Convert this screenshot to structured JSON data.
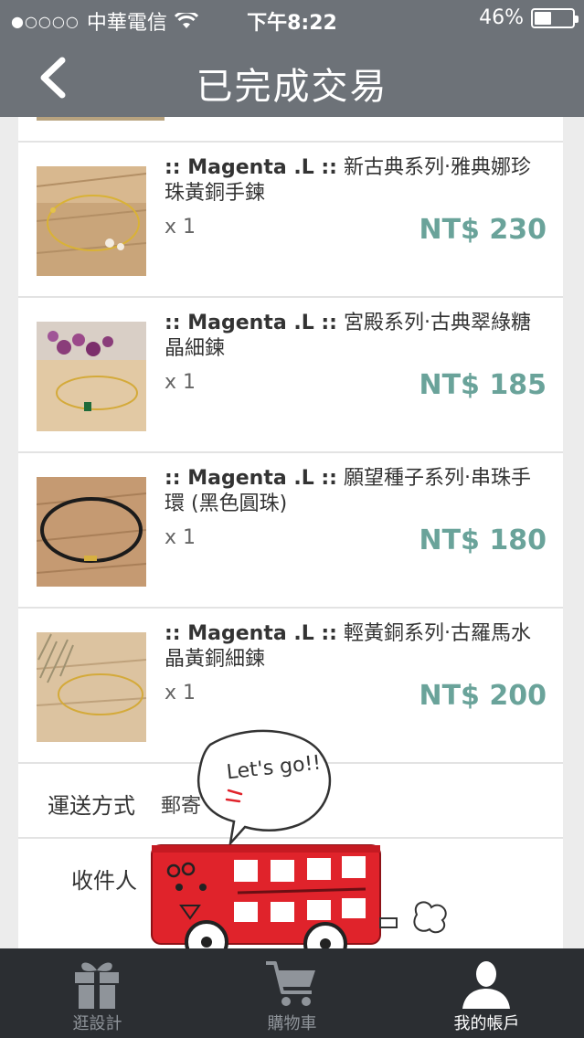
{
  "status_bar": {
    "carrier": "中華電信",
    "time": "下午8:22",
    "battery_pct": "46%",
    "battery_level": 0.46,
    "signal_dots": "●○○○○"
  },
  "nav": {
    "title": "已完成交易",
    "back_icon": "chevron-left-icon"
  },
  "items": [
    {
      "brand": ":: Magenta .L ::",
      "name": " 新古典系列‧雅典娜珍珠黃銅手鍊",
      "qty": "x 1",
      "price": "NT$ 230"
    },
    {
      "brand": ":: Magenta .L ::",
      "name": " 宮殿系列‧古典翠綠糖晶細鍊",
      "qty": "x 1",
      "price": "NT$ 185"
    },
    {
      "brand": ":: Magenta .L ::",
      "name": " 願望種子系列‧串珠手環 (黑色圓珠)",
      "qty": "x 1",
      "price": "NT$ 180"
    },
    {
      "brand": ":: Magenta .L ::",
      "name": " 輕黃銅系列‧古羅馬水晶黃銅細鍊",
      "qty": "x 1",
      "price": "NT$ 200"
    }
  ],
  "shipping": {
    "label": "運送方式",
    "value": "郵寄"
  },
  "recipient": {
    "label": "收件人"
  },
  "sticker": {
    "text": "Let's go!!"
  },
  "tabbar": {
    "tabs": [
      {
        "label": "逛設計",
        "icon": "gift-icon"
      },
      {
        "label": "購物車",
        "icon": "cart-icon"
      },
      {
        "label": "我的帳戶",
        "icon": "user-icon"
      }
    ],
    "active_index": 2
  },
  "colors": {
    "header": "#6d7278",
    "price": "#6aa39a",
    "tabbar": "#2b2e32",
    "bus": "#e0232b"
  }
}
